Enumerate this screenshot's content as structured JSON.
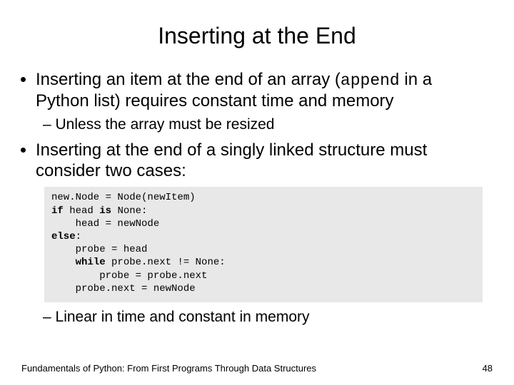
{
  "title": "Inserting at the End",
  "bullets": {
    "b1_pre": "Inserting an item at the end of an array (",
    "b1_code": "append",
    "b1_post": " in a Python list) requires constant time and memory",
    "b1_sub1": "Unless the array must be resized",
    "b2": "Inserting at the end of a singly linked structure must consider two cases:",
    "b2_sub1": "Linear in time and constant in memory"
  },
  "code": {
    "l1a": "new.Node = Node(newItem)",
    "l2_kw1": "if",
    "l2_mid": " head ",
    "l2_kw2": "is",
    "l2_end": " None:",
    "l3": "    head = newNode",
    "l4_kw": "else",
    "l4_end": ":",
    "l5": "    probe = head",
    "l6_pre": "    ",
    "l6_kw": "while",
    "l6_end": " probe.next != None:",
    "l7": "        probe = probe.next",
    "l8": "    probe.next = newNode"
  },
  "footer": {
    "text": "Fundamentals of Python: From First Programs Through Data Structures",
    "page": "48"
  }
}
